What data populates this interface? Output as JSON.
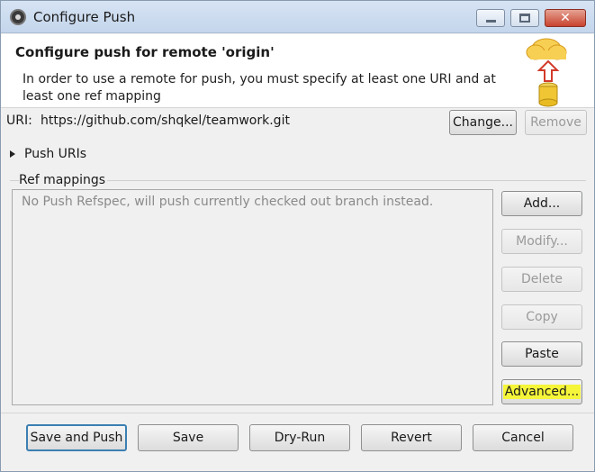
{
  "window": {
    "title": "Configure Push",
    "controls": {
      "minimize": "minimize",
      "maximize": "maximize",
      "close": "✕"
    }
  },
  "banner": {
    "title": "Configure push for remote 'origin'",
    "description": "In order to use a remote for push, you must specify at least one URI and at least one ref mapping",
    "icon": "cloud-push-icon"
  },
  "uri": {
    "label": "URI:",
    "value": "https://github.com/shqkel/teamwork.git",
    "change_label": "Change...",
    "remove_label": "Remove"
  },
  "push_uris": {
    "label": "Push URIs",
    "expanded": false
  },
  "ref_mappings": {
    "label": "Ref mappings",
    "empty_message": "No Push Refspec, will push currently checked out branch instead.",
    "buttons": {
      "add": "Add...",
      "modify": "Modify...",
      "delete": "Delete",
      "copy": "Copy",
      "paste": "Paste",
      "advanced": "Advanced..."
    }
  },
  "footer": {
    "save_and_push": "Save and Push",
    "save": "Save",
    "dry_run": "Dry-Run",
    "revert": "Revert",
    "cancel": "Cancel"
  },
  "colors": {
    "highlight": "#f5f53a",
    "default_button_border": "#3c7fb1",
    "close_button": "#c8432f"
  }
}
